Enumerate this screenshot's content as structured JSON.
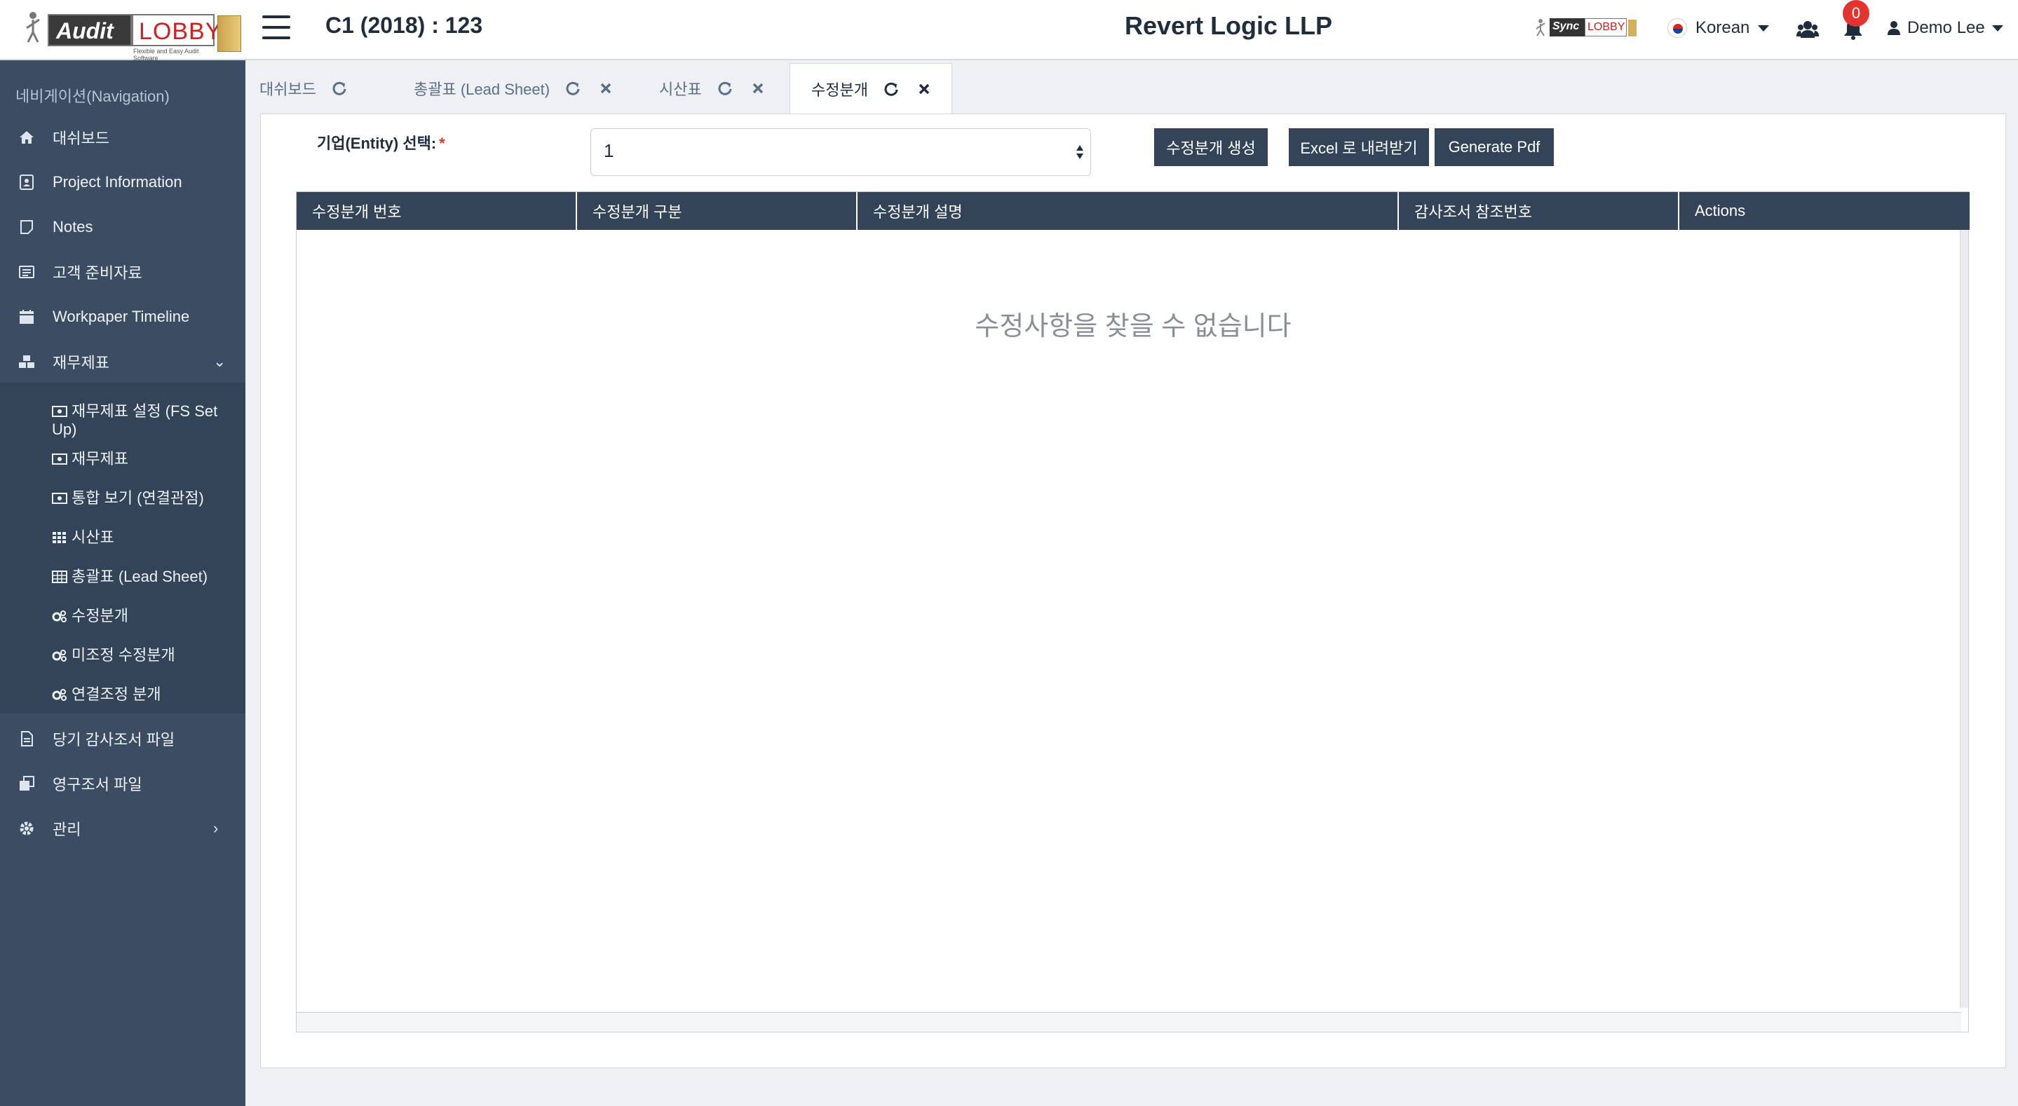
{
  "header": {
    "logo_audit": "Audit",
    "logo_lobby": "LOBBY",
    "logo_tagline": "Flexible and Easy Audit Software",
    "engagement_title": "C1 (2018) : 123",
    "firm_name": "Revert Logic LLP",
    "sync_logo_text": "Sync",
    "sync_logo_lobby": "LOBBY",
    "language": "Korean",
    "notification_count": "0",
    "user_name": "Demo Lee"
  },
  "sidebar": {
    "title": "네비게이션(Navigation)",
    "items": [
      {
        "label": "대쉬보드",
        "icon": "home-icon"
      },
      {
        "label": "Project Information",
        "icon": "info-icon"
      },
      {
        "label": "Notes",
        "icon": "note-icon"
      },
      {
        "label": "고객 준비자료",
        "icon": "list-icon"
      },
      {
        "label": "Workpaper Timeline",
        "icon": "calendar-icon"
      },
      {
        "label": "재무제표",
        "icon": "cubes-icon"
      },
      {
        "label": "당기 감사조서 파일",
        "icon": "file-icon"
      },
      {
        "label": "영구조서 파일",
        "icon": "clone-icon"
      },
      {
        "label": "관리",
        "icon": "gear-icon"
      }
    ],
    "submenu": [
      {
        "label": "재무제표 설정 (FS Set Up)",
        "icon": "money-icon"
      },
      {
        "label": "재무제표",
        "icon": "money-icon"
      },
      {
        "label": "통합 보기 (연결관점)",
        "icon": "money-icon"
      },
      {
        "label": "시산표",
        "icon": "grid-icon"
      },
      {
        "label": "총괄표 (Lead Sheet)",
        "icon": "table-icon"
      },
      {
        "label": "수정분개",
        "icon": "gears-icon"
      },
      {
        "label": "미조정 수정분개",
        "icon": "gears-icon"
      },
      {
        "label": "연결조정 분개",
        "icon": "gears-icon"
      }
    ]
  },
  "tabs": [
    {
      "label": "대쉬보드",
      "closable": false
    },
    {
      "label": "총괄표 (Lead Sheet)",
      "closable": true
    },
    {
      "label": "시산표",
      "closable": true
    },
    {
      "label": "수정분개",
      "closable": true,
      "active": true
    }
  ],
  "form": {
    "entity_label": "기업(Entity) 선택:",
    "required_mark": "*",
    "entity_value": "1"
  },
  "buttons": {
    "create": "수정분개 생성",
    "excel": "Excel 로 내려받기",
    "pdf": "Generate Pdf"
  },
  "table": {
    "columns": [
      "수정분개 번호",
      "수정분개 구분",
      "수정분개 설명",
      "감사조서 참조번호",
      "Actions"
    ],
    "empty_message": "수정사항을 찾을 수 없습니다"
  },
  "colors": {
    "sidebar_bg": "#3c4d63",
    "submenu_bg": "#334358",
    "header_dark": "#334358",
    "badge": "#e3342f"
  }
}
